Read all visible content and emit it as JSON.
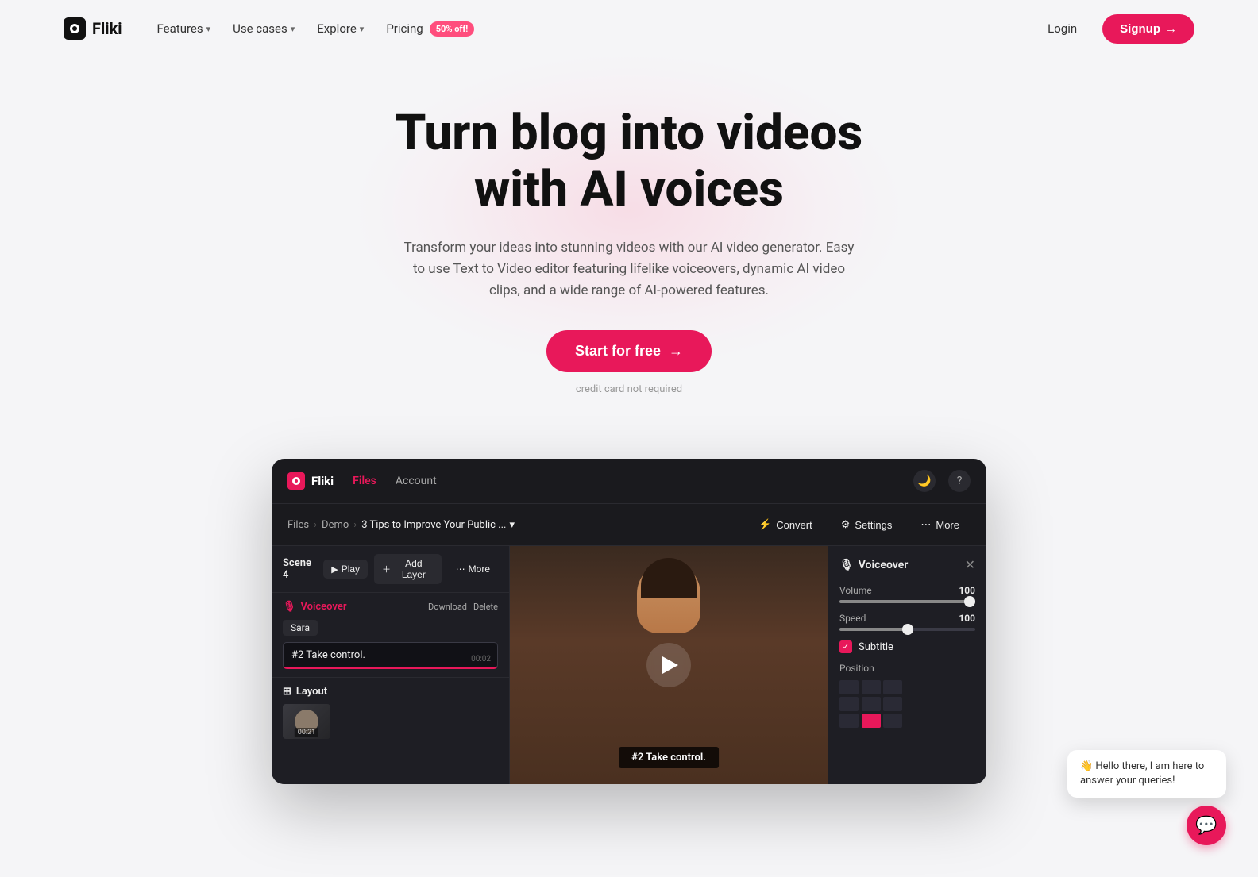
{
  "navbar": {
    "logo_text": "Fliki",
    "features_label": "Features",
    "use_cases_label": "Use cases",
    "explore_label": "Explore",
    "pricing_label": "Pricing",
    "badge_50off": "50% off!",
    "login_label": "Login",
    "signup_label": "Signup",
    "signup_arrow": "→"
  },
  "hero": {
    "heading_line1": "Turn blog into videos",
    "heading_line2": "with AI voices",
    "subtitle": "Transform your ideas into stunning videos with our AI video generator. Easy to use Text to Video editor featuring lifelike voiceovers, dynamic AI video clips, and a wide range of AI-powered features.",
    "cta_label": "Start for free",
    "cta_arrow": "→",
    "credit_note": "credit card not required"
  },
  "app_preview": {
    "app_navbar": {
      "logo_text": "Fliki",
      "files_label": "Files",
      "account_label": "Account",
      "dark_mode_icon": "🌙",
      "help_icon": "?"
    },
    "breadcrumb": {
      "files_label": "Files",
      "demo_label": "Demo",
      "current_label": "3 Tips to Improve Your Public ...",
      "convert_label": "Convert",
      "settings_label": "Settings",
      "more_label": "More"
    },
    "left_panel": {
      "scene_label": "Scene 4",
      "play_label": "Play",
      "add_layer_label": "Add Layer",
      "more_label": "More",
      "voiceover_title": "Voiceover",
      "download_label": "Download",
      "delete_label": "Delete",
      "sara_label": "Sara",
      "vo_text": "#2 Take control.",
      "timestamp": "00:02",
      "layout_title": "Layout",
      "thumb_time": "00:21"
    },
    "video": {
      "caption": "#2 Take control."
    },
    "right_panel": {
      "title": "Voiceover",
      "mic_icon": "🎙",
      "close_icon": "✕",
      "volume_label": "Volume",
      "volume_value": "100",
      "speed_label": "Speed",
      "speed_value": "100",
      "subtitle_label": "Subtitle",
      "position_label": "Position",
      "volume_fill_pct": 100,
      "speed_fill_pct": 50
    },
    "chat": {
      "bubble_text": "👋 Hello there, I am here to answer your queries!",
      "avatar_emoji": "💬"
    }
  }
}
